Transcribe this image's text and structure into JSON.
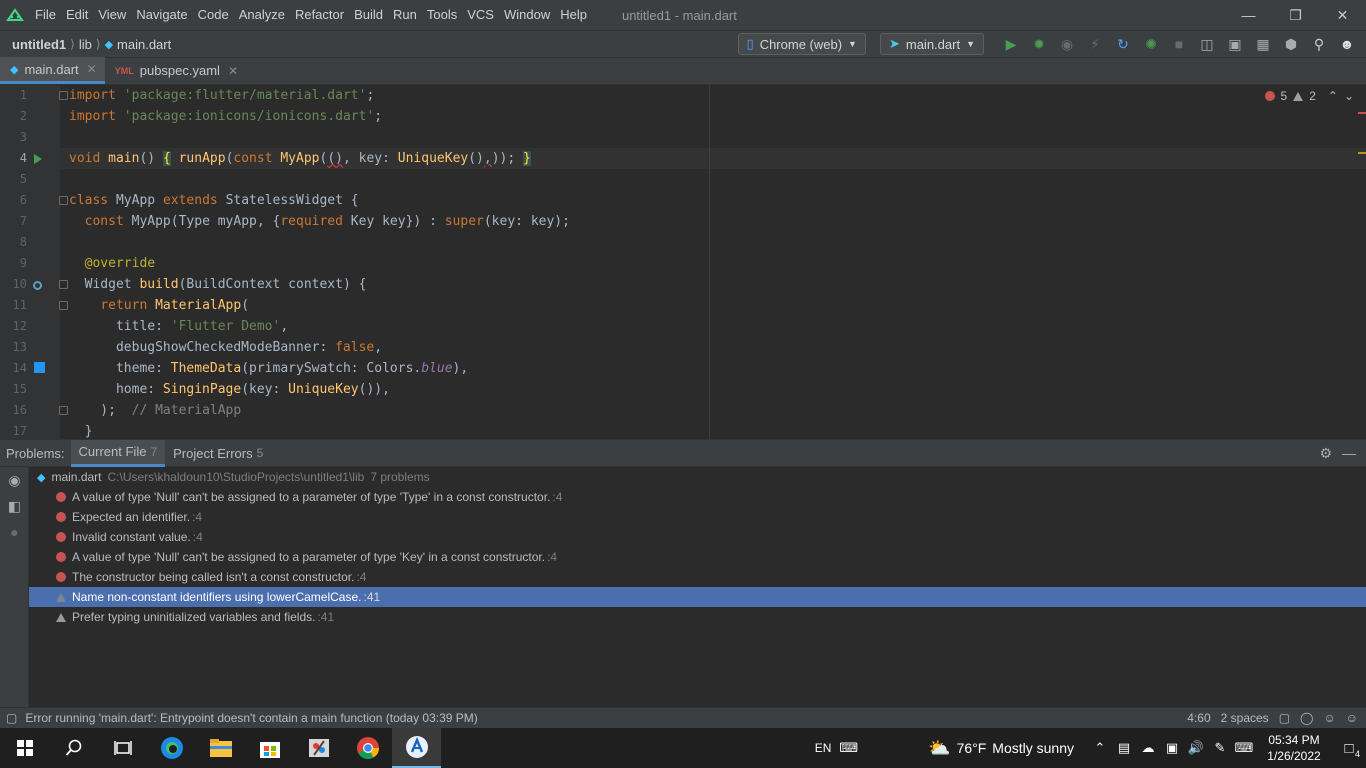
{
  "window": {
    "title": "untitled1 - main.dart",
    "menu": [
      "File",
      "Edit",
      "View",
      "Navigate",
      "Code",
      "Analyze",
      "Refactor",
      "Build",
      "Run",
      "Tools",
      "VCS",
      "Window",
      "Help"
    ]
  },
  "breadcrumbs": [
    "untitled1",
    "lib",
    "main.dart"
  ],
  "toolbar": {
    "device": "Chrome (web)",
    "run_config": "main.dart"
  },
  "tabs": [
    {
      "label": "main.dart",
      "active": true
    },
    {
      "label": "pubspec.yaml",
      "active": false
    }
  ],
  "editor": {
    "errors": "5",
    "warnings": "2",
    "line_numbers": [
      "1",
      "2",
      "3",
      "4",
      "5",
      "6",
      "7",
      "8",
      "9",
      "10",
      "11",
      "12",
      "13",
      "14",
      "15",
      "16",
      "17"
    ],
    "lines": [
      "import 'package:flutter/material.dart';",
      "import 'package:ionicons/ionicons.dart';",
      "",
      "void main() { runApp(const MyApp((), key: UniqueKey(),)); }",
      "",
      "class MyApp extends StatelessWidget {",
      "  const MyApp(Type myApp, {required Key key}) : super(key: key);",
      "",
      "  @override",
      "  Widget build(BuildContext context) {",
      "    return MaterialApp(",
      "      title: 'Flutter Demo',",
      "      debugShowCheckedModeBanner: false,",
      "      theme: ThemeData(primarySwatch: Colors.blue),",
      "      home: SinginPage(key: UniqueKey()),",
      "    );  // MaterialApp",
      "  }"
    ]
  },
  "problems": {
    "title": "Problems:",
    "tabs": [
      {
        "label": "Current File",
        "count": "7"
      },
      {
        "label": "Project Errors",
        "count": "5"
      }
    ],
    "file": "main.dart",
    "path": "C:\\Users\\khaldoun10\\StudioProjects\\untitled1\\lib",
    "summary": "7 problems",
    "items": [
      {
        "severity": "error",
        "text": "A value of type 'Null' can't be assigned to a parameter of type 'Type' in a const constructor.",
        "loc": ":4"
      },
      {
        "severity": "error",
        "text": "Expected an identifier.",
        "loc": ":4"
      },
      {
        "severity": "error",
        "text": "Invalid constant value.",
        "loc": ":4"
      },
      {
        "severity": "error",
        "text": "A value of type 'Null' can't be assigned to a parameter of type 'Key' in a const constructor.",
        "loc": ":4"
      },
      {
        "severity": "error",
        "text": "The constructor being called isn't a const constructor.",
        "loc": ":4"
      },
      {
        "severity": "warning",
        "text": "Name non-constant identifiers using lowerCamelCase.",
        "loc": ":41",
        "selected": true
      },
      {
        "severity": "warning",
        "text": "Prefer typing uninitialized variables and fields.",
        "loc": ":41"
      }
    ]
  },
  "status": {
    "message": "Error running 'main.dart': Entrypoint doesn't contain a main function (today 03:39 PM)",
    "position": "4:60",
    "indent": "2 spaces"
  },
  "taskbar": {
    "weather_temp": "76°F",
    "weather_text": "Mostly sunny",
    "lang": "EN",
    "time": "05:34 PM",
    "date": "1/26/2022",
    "notifications": "4"
  },
  "colors": {
    "error": "#c75450",
    "selection": "#4b6eaf",
    "accent": "#4a88c7"
  }
}
